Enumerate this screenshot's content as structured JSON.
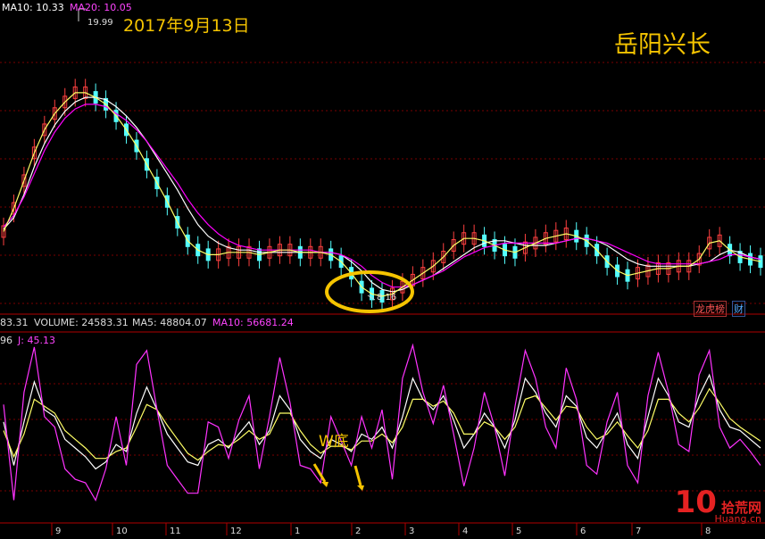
{
  "colors": {
    "background": "#000000",
    "grid": "#7a0000",
    "candle_up": "#ff4040",
    "candle_down": "#54ffff",
    "ma10": "#ffffff",
    "ma20": "#ff00ff",
    "ma5": "#ffff66",
    "annotation": "#f5c400",
    "label_text": "#e0e0e0"
  },
  "header": {
    "ma10_label": "MA10: 10.33",
    "ma20_label": "MA20: 10.05",
    "volume_prefix": "83.31",
    "volume_label": "VOLUME: 24583.31",
    "vol_ma5_label": "MA5: 48804.07",
    "vol_ma10_label": "MA10: 56681.24",
    "kdj_prefix": "96",
    "kdj_j_label": "J: 45.13"
  },
  "annotations": {
    "date": "2017年9月13日",
    "stock_name": "岳阳兴长",
    "w_bottom": "W底",
    "high_price": "19.99",
    "low_price": "8.16"
  },
  "tags": {
    "tag_left": "龙虎榜",
    "tag_right": "财"
  },
  "watermark": {
    "number": "10",
    "cn": "拾荒网",
    "en": "Huang.cn"
  },
  "chart_data": [
    {
      "type": "candlestick",
      "panel": "price",
      "title": "",
      "series": [
        {
          "name": "MA10",
          "values": [
            10.9,
            11.4,
            12.4,
            13.6,
            14.6,
            15.4,
            16.0,
            16.4,
            16.6,
            16.6,
            16.5,
            16.2,
            15.8,
            15.3,
            14.7,
            14.0,
            13.3,
            12.6,
            11.8,
            11.1,
            10.6,
            10.3,
            10.1,
            10.0,
            10.0,
            9.9,
            9.9,
            9.9,
            9.9,
            9.9,
            9.9,
            9.9,
            9.9,
            9.8,
            9.5,
            9.1,
            8.6,
            8.3,
            8.2,
            8.3,
            8.5,
            8.7,
            8.9,
            9.2,
            9.5,
            9.8,
            10.1,
            10.3,
            10.4,
            10.4,
            10.3,
            10.2,
            10.2,
            10.2,
            10.3,
            10.4,
            10.5,
            10.5,
            10.4,
            10.2,
            9.9,
            9.6,
            9.4,
            9.3,
            9.3,
            9.3,
            9.3,
            9.3,
            9.4,
            9.5,
            9.8,
            10.0,
            9.9,
            9.7,
            9.6
          ]
        },
        {
          "name": "MA20",
          "values": [
            11.0,
            11.5,
            12.3,
            13.3,
            14.3,
            15.1,
            15.7,
            16.1,
            16.3,
            16.3,
            16.2,
            15.9,
            15.6,
            15.2,
            14.7,
            14.1,
            13.5,
            12.9,
            12.2,
            11.6,
            11.1,
            10.7,
            10.4,
            10.2,
            10.1,
            10.0,
            10.0,
            10.0,
            10.0,
            10.0,
            10.0,
            9.9,
            9.9,
            9.8,
            9.6,
            9.3,
            8.9,
            8.6,
            8.4,
            8.4,
            8.5,
            8.7,
            8.9,
            9.1,
            9.4,
            9.7,
            9.9,
            10.1,
            10.2,
            10.3,
            10.3,
            10.3,
            10.3,
            10.3,
            10.3,
            10.4,
            10.5,
            10.5,
            10.4,
            10.3,
            10.1,
            9.9,
            9.7,
            9.5,
            9.4,
            9.4,
            9.4,
            9.4,
            9.4,
            9.5,
            9.6,
            9.8,
            9.8,
            9.7,
            9.6
          ]
        },
        {
          "name": "MA5",
          "values": [
            10.8,
            11.8,
            13.0,
            14.2,
            15.2,
            15.9,
            16.4,
            16.8,
            16.8,
            16.6,
            16.3,
            15.8,
            15.2,
            14.5,
            13.7,
            12.9,
            12.1,
            11.2,
            10.4,
            10.0,
            9.8,
            9.8,
            9.9,
            9.9,
            9.9,
            9.8,
            9.9,
            10.0,
            10.0,
            9.9,
            9.9,
            9.9,
            9.8,
            9.5,
            9.0,
            8.4,
            8.1,
            8.0,
            8.1,
            8.4,
            8.7,
            9.0,
            9.3,
            9.7,
            10.2,
            10.5,
            10.5,
            10.4,
            10.2,
            10.0,
            9.9,
            10.1,
            10.3,
            10.5,
            10.6,
            10.7,
            10.6,
            10.4,
            10.0,
            9.5,
            9.1,
            8.9,
            9.0,
            9.1,
            9.2,
            9.2,
            9.3,
            9.3,
            9.6,
            10.3,
            10.4,
            10.0,
            9.7,
            9.6,
            9.5
          ]
        }
      ],
      "annotations": [
        {
          "label": "19.99",
          "kind": "high"
        },
        {
          "label": "8.16",
          "kind": "low"
        }
      ]
    },
    {
      "type": "line",
      "panel": "kdj",
      "title": "",
      "x_ticks": [
        "9",
        "10",
        "11",
        "12",
        "1",
        "2",
        "3",
        "4",
        "5",
        "6",
        "7",
        "8"
      ],
      "series": [
        {
          "name": "K",
          "values": [
            55,
            30,
            55,
            78,
            62,
            58,
            45,
            40,
            35,
            28,
            32,
            42,
            38,
            60,
            75,
            62,
            48,
            40,
            32,
            30,
            42,
            45,
            40,
            48,
            55,
            42,
            50,
            70,
            62,
            45,
            38,
            34,
            45,
            42,
            38,
            48,
            45,
            52,
            40,
            58,
            80,
            68,
            62,
            70,
            56,
            40,
            48,
            60,
            52,
            40,
            56,
            80,
            72,
            60,
            52,
            70,
            64,
            46,
            40,
            50,
            60,
            42,
            34,
            58,
            80,
            70,
            55,
            52,
            70,
            82,
            62,
            52,
            50,
            45,
            40
          ]
        },
        {
          "name": "D",
          "values": [
            50,
            35,
            48,
            68,
            64,
            60,
            50,
            45,
            40,
            34,
            34,
            38,
            40,
            52,
            65,
            62,
            53,
            45,
            37,
            33,
            38,
            42,
            41,
            45,
            50,
            45,
            48,
            60,
            60,
            50,
            42,
            37,
            41,
            41,
            39,
            44,
            44,
            48,
            43,
            52,
            68,
            68,
            64,
            67,
            60,
            48,
            48,
            55,
            52,
            45,
            52,
            68,
            70,
            63,
            56,
            64,
            63,
            52,
            45,
            48,
            55,
            47,
            40,
            50,
            68,
            68,
            60,
            55,
            63,
            74,
            66,
            57,
            52,
            48,
            44
          ]
        },
        {
          "name": "J",
          "values": [
            65,
            10,
            72,
            98,
            58,
            52,
            28,
            22,
            20,
            10,
            28,
            58,
            30,
            88,
            96,
            62,
            30,
            22,
            14,
            14,
            55,
            52,
            34,
            56,
            70,
            28,
            58,
            92,
            66,
            30,
            28,
            20,
            58,
            44,
            30,
            58,
            40,
            62,
            22,
            80,
            99,
            72,
            54,
            76,
            48,
            18,
            40,
            72,
            52,
            24,
            64,
            96,
            80,
            52,
            40,
            86,
            68,
            30,
            25,
            55,
            72,
            30,
            20,
            70,
            95,
            72,
            42,
            38,
            82,
            96,
            52,
            40,
            45,
            38,
            30
          ]
        }
      ]
    }
  ]
}
